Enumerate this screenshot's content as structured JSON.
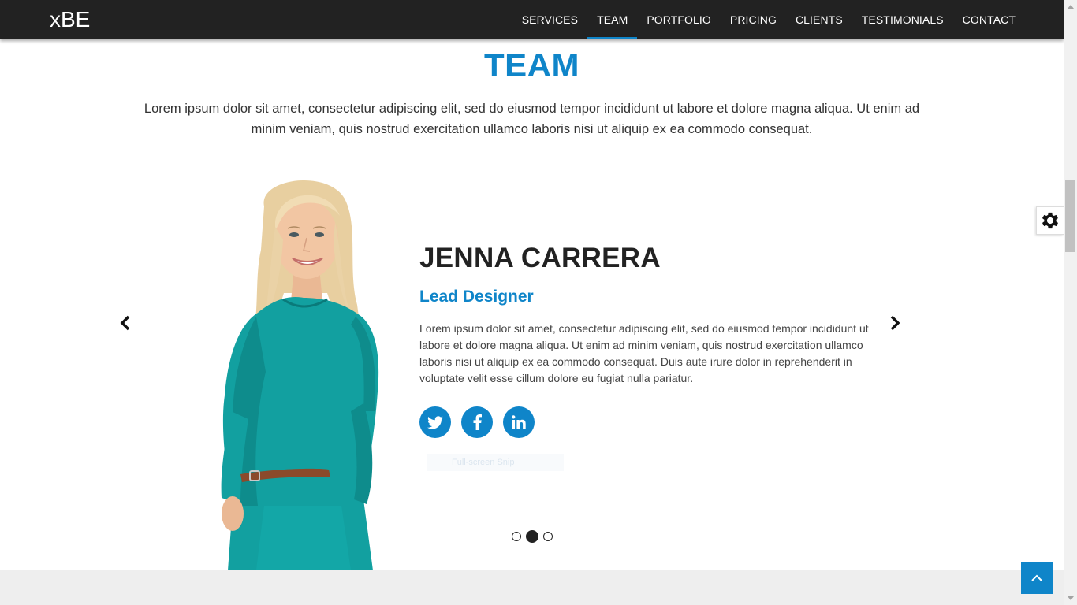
{
  "navbar": {
    "brand": "xBE",
    "items": [
      {
        "label": "SERVICES"
      },
      {
        "label": "TEAM"
      },
      {
        "label": "PORTFOLIO"
      },
      {
        "label": "PRICING"
      },
      {
        "label": "CLIENTS"
      },
      {
        "label": "TESTIMONIALS"
      },
      {
        "label": "CONTACT"
      }
    ],
    "active": "TEAM"
  },
  "section": {
    "title": "TEAM",
    "intro": "Lorem ipsum dolor sit amet, consectetur adipiscing elit, sed do eiusmod tempor incididunt ut labore et dolore magna aliqua. Ut enim ad minim veniam, quis nostrud exercitation ullamco laboris nisi ut aliquip ex ea commodo consequat."
  },
  "member": {
    "name": "JENNA CARRERA",
    "role": "Lead Designer",
    "bio": "Lorem ipsum dolor sit amet, consectetur adipiscing elit, sed do eiusmod tempor incididunt ut labore et dolore magna aliqua. Ut enim ad minim veniam, quis nostrud exercitation ullamco laboris nisi ut aliquip ex ea commodo consequat. Duis aute irure dolor in reprehenderit in voluptate velit esse cillum dolore eu fugiat nulla pariatur.",
    "social": [
      {
        "icon": "twitter-icon"
      },
      {
        "icon": "facebook-icon"
      },
      {
        "icon": "linkedin-icon"
      }
    ]
  },
  "ghost_text": "Full-screen Snip",
  "carousel": {
    "slide_count": 3,
    "active_slide": 2
  },
  "colors": {
    "accent": "#0f85c9",
    "navbar_bg": "#222222",
    "dress": "#12a0a0",
    "footer_band": "#eeeeee"
  },
  "icons": {
    "prev": "chevron-left-icon",
    "next": "chevron-right-icon",
    "settings": "gear-icon",
    "back_to_top": "chevron-up-icon"
  }
}
